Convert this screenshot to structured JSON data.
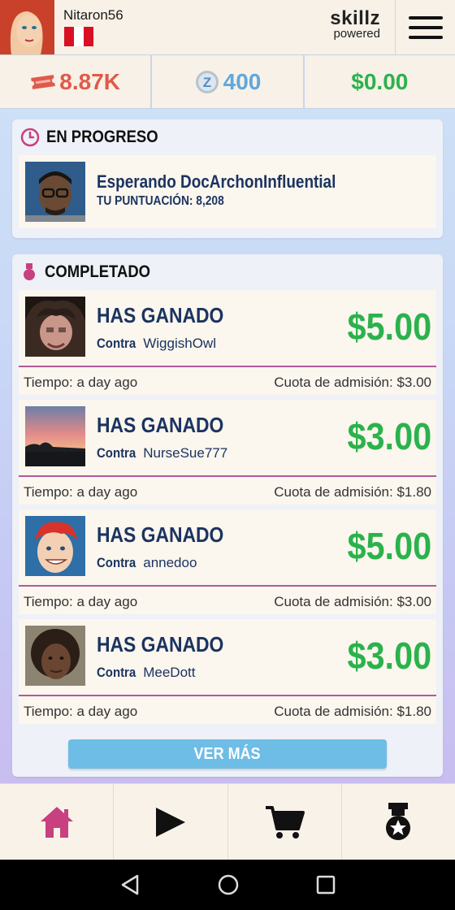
{
  "header": {
    "username": "Nitaron56",
    "brand_line1": "skillz",
    "brand_line2": "powered"
  },
  "currency": {
    "tickets": "8.87K",
    "z_coins": "400",
    "cash": "$0.00"
  },
  "in_progress": {
    "title": "EN PROGRESO",
    "match": {
      "waiting_text": "Esperando DocArchonInfluential",
      "score_text": "TU PUNTUACIÓN: 8,208"
    }
  },
  "completed": {
    "title": "COMPLETADO",
    "games": [
      {
        "result": "HAS GANADO",
        "vs_label": "Contra",
        "opponent": "WiggishOwl",
        "amount": "$5.00",
        "time": "Tiempo: a day ago",
        "fee": "Cuota de admisión: $3.00"
      },
      {
        "result": "HAS GANADO",
        "vs_label": "Contra",
        "opponent": "NurseSue777",
        "amount": "$3.00",
        "time": "Tiempo: a day ago",
        "fee": "Cuota de admisión: $1.80"
      },
      {
        "result": "HAS GANADO",
        "vs_label": "Contra",
        "opponent": "annedoo",
        "amount": "$5.00",
        "time": "Tiempo: a day ago",
        "fee": "Cuota de admisión: $3.00"
      },
      {
        "result": "HAS GANADO",
        "vs_label": "Contra",
        "opponent": "MeeDott",
        "amount": "$3.00",
        "time": "Tiempo: a day ago",
        "fee": "Cuota de admisión: $1.80"
      }
    ],
    "more_label": "VER MÁS"
  },
  "nav": {
    "items": [
      "home-icon",
      "play-icon",
      "cart-icon",
      "medal-icon"
    ]
  },
  "colors": {
    "accent_pink": "#c8407f",
    "cash_green": "#2bb24c",
    "ticket_red": "#e05a4c",
    "z_blue": "#5fa8dd",
    "title_navy": "#1b3460",
    "button_blue": "#6dbde6"
  }
}
